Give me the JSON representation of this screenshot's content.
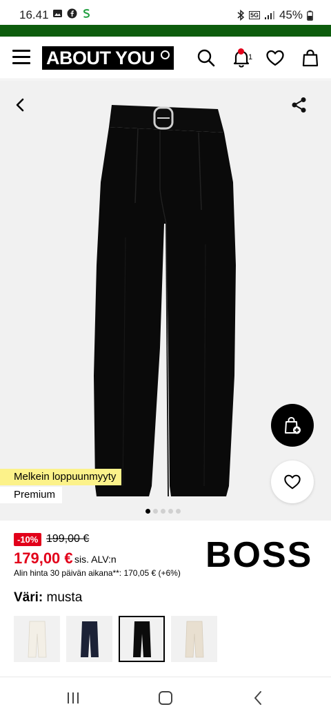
{
  "status_bar": {
    "time": "16.41",
    "battery": "45%",
    "network": "5G"
  },
  "header": {
    "logo_text": "ABOUT YOU",
    "notification_count": "1",
    "icons": [
      "menu-icon",
      "search-icon",
      "bell-icon",
      "heart-icon",
      "bag-icon"
    ]
  },
  "gallery": {
    "tag_low_stock": "Melkein loppuunmyyty",
    "tag_premium": "Premium",
    "image_count": 5,
    "active_index": 0
  },
  "pricing": {
    "discount": "-10%",
    "old_price": "199,00 €",
    "new_price": "179,00 €",
    "vat_note": "sis. ALV:n",
    "lowest_price_note": "Alin hinta 30 päivän aikana**: 170,05 € (+6%)"
  },
  "brand": "BOSS",
  "color": {
    "label": "Väri:",
    "value": "musta",
    "swatch_colors": [
      "#f3efe6",
      "#1c2236",
      "#0c0c0c",
      "#e8dfd0"
    ],
    "selected_index": 2
  },
  "colors": {
    "green_bar": "#0d5c0d",
    "sale_red": "#e2001a",
    "tag_yellow": "#fcf28a"
  }
}
